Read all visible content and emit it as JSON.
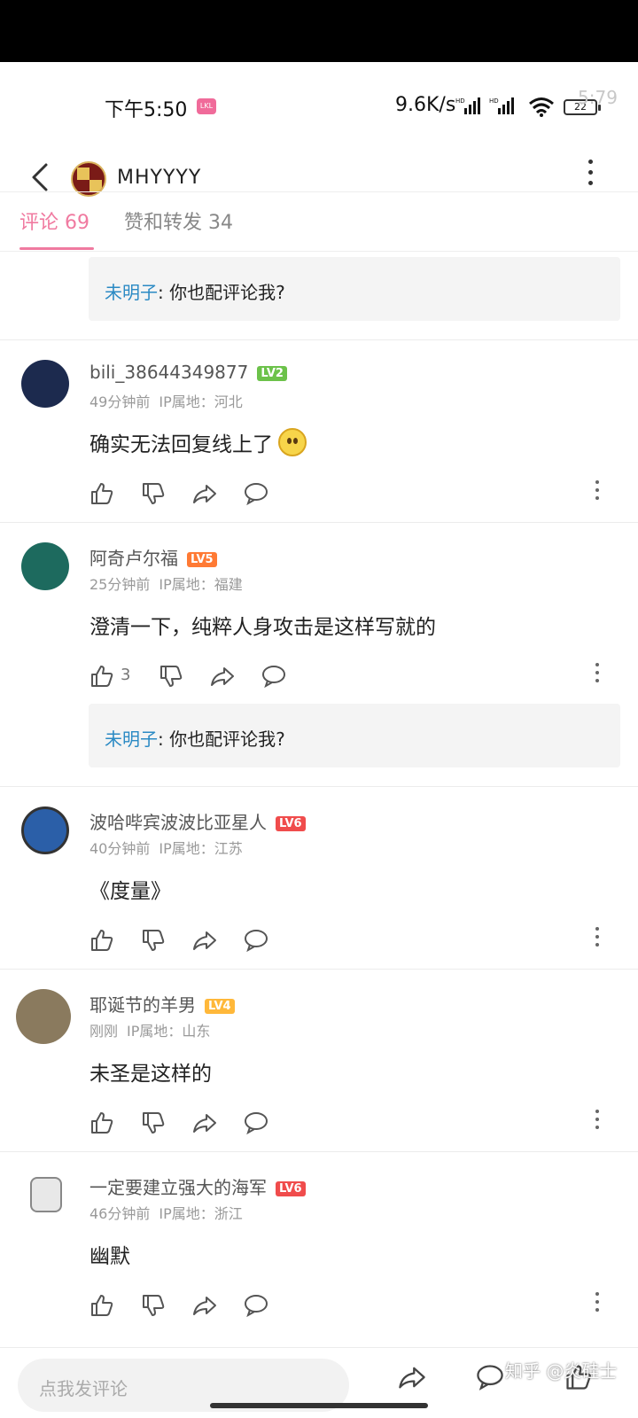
{
  "status_bar": {
    "time": "下午5:50",
    "app_badge": "LKL",
    "net_speed": "9.6K/s",
    "signal1_label": "HD",
    "signal2_label": "HD",
    "battery": "22",
    "ghost_text": "5:79"
  },
  "header": {
    "title": "MHYYYY"
  },
  "tabs": [
    {
      "label": "评论 69",
      "active": true
    },
    {
      "label": "赞和转发 34",
      "active": false
    }
  ],
  "top_reply": {
    "name": "未明子",
    "sep": ": ",
    "text": "你也配评论我?"
  },
  "comments": [
    {
      "username": "bili_38644349877",
      "level": "LV2",
      "level_color": "#6cc24a",
      "time": "49分钟前",
      "ip": "IP属地：河北",
      "text": "确实无法回复线上了",
      "like_count": "",
      "avatar_color": "#1c2a4e"
    },
    {
      "username": "阿奇卢尔福",
      "level": "LV5",
      "level_color": "#ff7a34",
      "time": "25分钟前",
      "ip": "IP属地：福建",
      "text": "澄清一下，纯粹人身攻击是这样写就的",
      "like_count": "3",
      "avatar_color": "#1d6a5e",
      "reply": {
        "name": "未明子",
        "sep": ": ",
        "text": "你也配评论我?"
      }
    },
    {
      "username": "波哈哔宾波波比亚星人",
      "level": "LV6",
      "level_color": "#f04c4c",
      "time": "40分钟前",
      "ip": "IP属地：江苏",
      "text": "《度量》",
      "like_count": "",
      "avatar_color": "#2b5fa8"
    },
    {
      "username": "耶诞节的羊男",
      "level": "LV4",
      "level_color": "#ffb83a",
      "time": "刚刚",
      "ip": "IP属地：山东",
      "text": "未圣是这样的",
      "like_count": "",
      "avatar_color": "#8a7a5e"
    },
    {
      "username": "一定要建立强大的海军",
      "level": "LV6",
      "level_color": "#f04c4c",
      "time": "46分钟前",
      "ip": "IP属地：浙江",
      "text": "幽默",
      "like_count": "",
      "avatar_color": "#e8e8e8"
    }
  ],
  "bottom_bar": {
    "input_placeholder": "点我发评论",
    "watermark": "知乎 @炎硅士"
  },
  "colors": {
    "accent": "#f07aa0",
    "link": "#2b8ac4"
  }
}
